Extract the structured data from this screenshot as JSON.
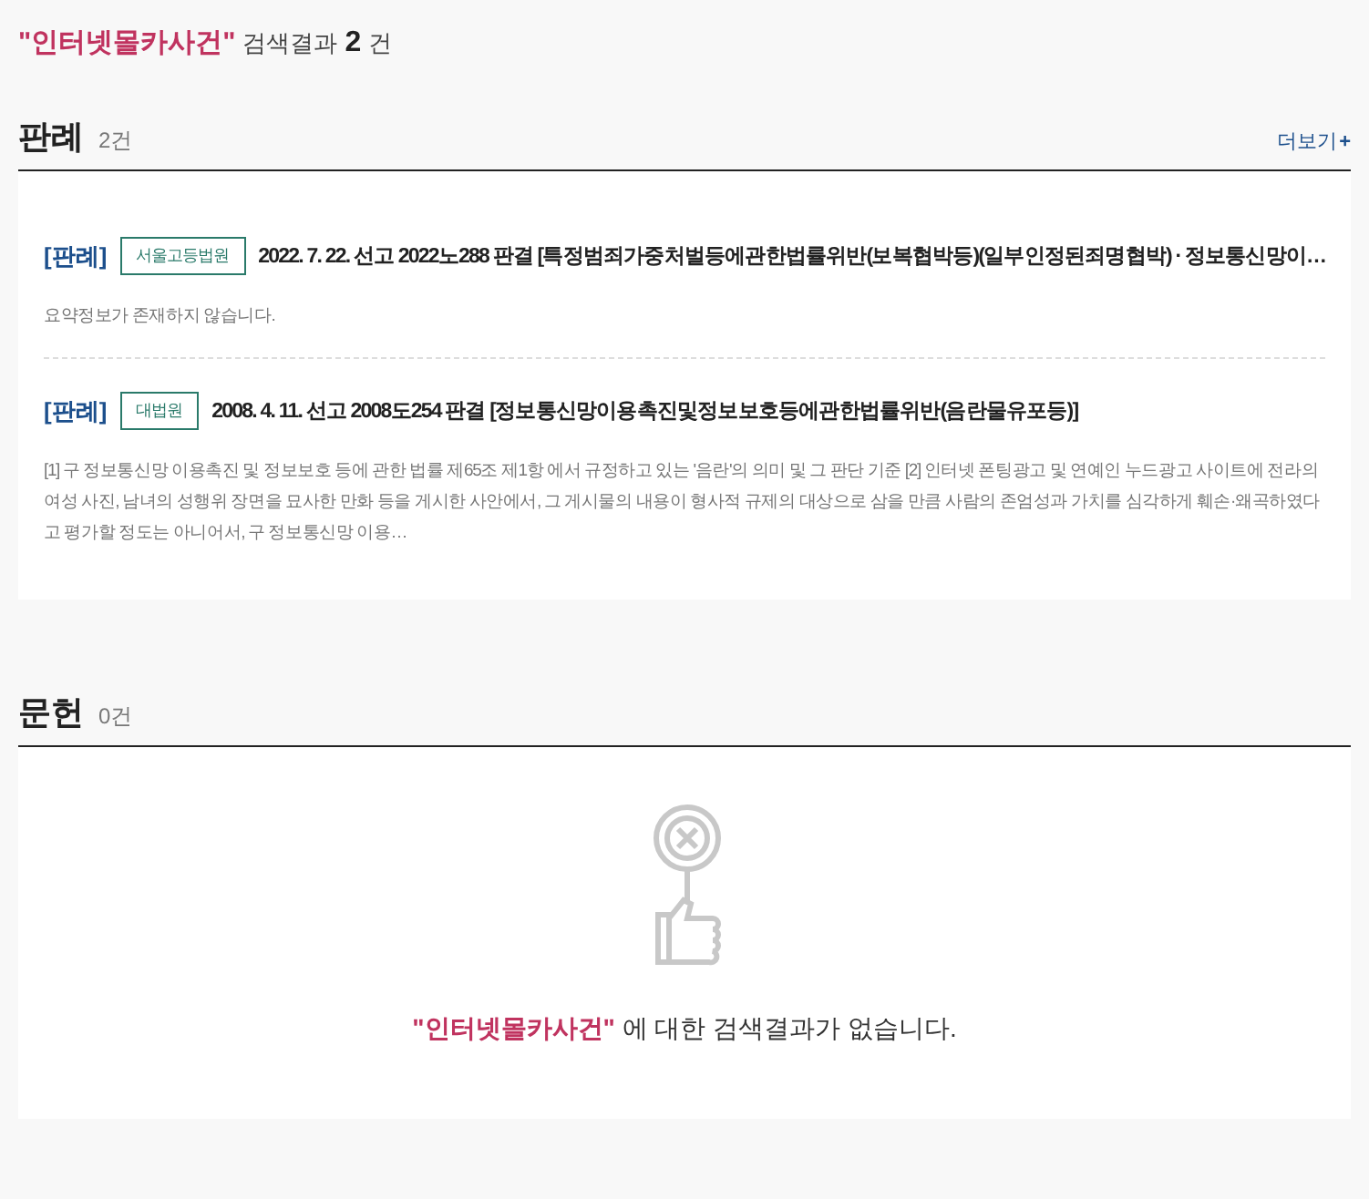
{
  "search_summary": {
    "query": "\"인터넷몰카사건\"",
    "label": "검색결과",
    "count": "2",
    "unit": "건"
  },
  "sections": [
    {
      "title": "판례",
      "count": "2건",
      "more_link": "더보기",
      "more_icon": "+",
      "items": [
        {
          "type_tag": "[판례]",
          "court": "서울고등법원",
          "title": "2022. 7. 22. 선고 2022노288 판결 [특정범죄가중처벌등에관한법률위반(보복협박등)(일부인정된죄명협박) · 정보통신망이…",
          "summary": "요약정보가 존재하지 않습니다."
        },
        {
          "type_tag": "[판례]",
          "court": "대법원",
          "title": "2008. 4. 11. 선고 2008도254 판결 [정보통신망이용촉진및정보보호등에관한법률위반(음란물유포등)]",
          "summary": "[1] 구 정보통신망 이용촉진 및 정보보호 등에 관한 법률 제65조 제1항 에서 규정하고 있는 '음란'의 의미 및 그 판단 기준 [2] 인터넷 폰팅광고 및 연예인 누드광고 사이트에 전라의 여성 사진, 남녀의 성행위 장면을 묘사한 만화 등을 게시한 사안에서, 그 게시물의 내용이 형사적 규제의 대상으로 삼을 만큼 사람의 존엄성과 가치를 심각하게 훼손·왜곡하였다고 평가할 정도는 아니어서, 구 정보통신망 이용…"
        }
      ]
    },
    {
      "title": "문헌",
      "count": "0건",
      "empty": {
        "query": "\"인터넷몰카사건\"",
        "message": "에 대한 검색결과가 없습니다."
      }
    }
  ]
}
